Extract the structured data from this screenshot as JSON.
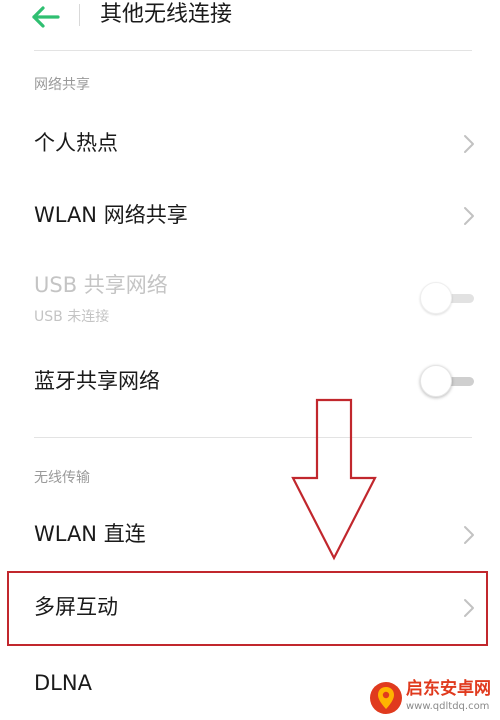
{
  "header": {
    "title": "其他无线连接",
    "back_icon": "arrow-left-icon",
    "accent_color": "#2fbf71"
  },
  "sections": [
    {
      "label": "网络共享",
      "items": [
        {
          "label": "个人热点",
          "control": "chevron"
        },
        {
          "label": "WLAN 网络共享",
          "control": "chevron"
        },
        {
          "label": "USB 共享网络",
          "sublabel": "USB 未连接",
          "control": "toggle",
          "enabled": false,
          "on": false
        },
        {
          "label": "蓝牙共享网络",
          "control": "toggle",
          "enabled": true,
          "on": false
        }
      ]
    },
    {
      "label": "无线传输",
      "items": [
        {
          "label": "WLAN 直连",
          "control": "chevron"
        },
        {
          "label": "多屏互动",
          "control": "chevron",
          "highlighted": true
        },
        {
          "label": "DLNA",
          "control": "none"
        }
      ]
    }
  ],
  "annotation": {
    "highlight_color": "#c1272d",
    "arrow": "down-arrow-icon"
  },
  "watermark": {
    "title": "启东安卓网",
    "url": "www.qdltdq.com",
    "brand_color": "#e03a1e"
  }
}
